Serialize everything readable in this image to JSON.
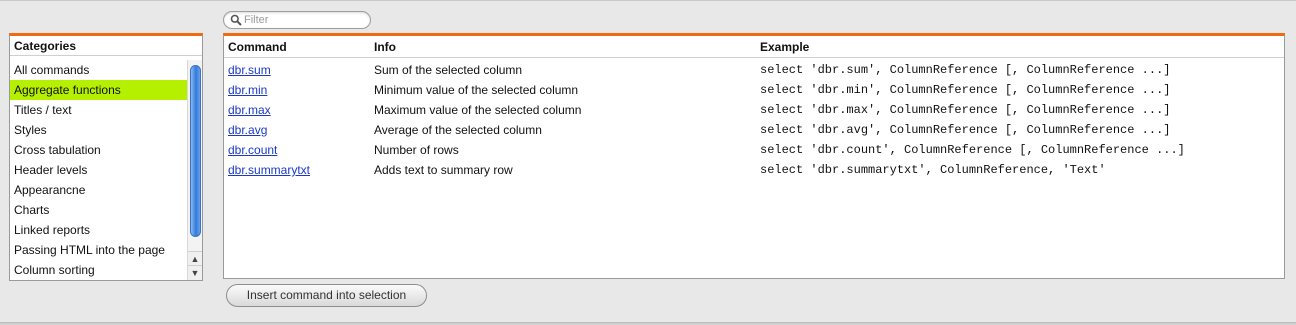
{
  "filter": {
    "placeholder": "Filter",
    "value": ""
  },
  "categories": {
    "header": "Categories",
    "selected_index": 1,
    "items": [
      "All commands",
      "Aggregate functions",
      "Titles / text",
      "Styles",
      "Cross tabulation",
      "Header levels",
      "Appearancne",
      "Charts",
      "Linked reports",
      "Passing HTML into the page",
      "Column sorting"
    ]
  },
  "commands": {
    "columns": {
      "command": "Command",
      "info": "Info",
      "example": "Example"
    },
    "rows": [
      {
        "command": "dbr.sum",
        "info": "Sum of the selected column",
        "example": "select 'dbr.sum', ColumnReference [, ColumnReference ...]"
      },
      {
        "command": "dbr.min",
        "info": "Minimum value of the selected column",
        "example": "select 'dbr.min', ColumnReference [, ColumnReference ...]"
      },
      {
        "command": "dbr.max",
        "info": "Maximum value of the selected column",
        "example": "select 'dbr.max', ColumnReference [, ColumnReference ...]"
      },
      {
        "command": "dbr.avg",
        "info": "Average of the selected column",
        "example": "select 'dbr.avg', ColumnReference [, ColumnReference ...]"
      },
      {
        "command": "dbr.count",
        "info": "Number of rows",
        "example": "select 'dbr.count', ColumnReference [, ColumnReference ...]"
      },
      {
        "command": "dbr.summarytxt",
        "info": "Adds text to summary row",
        "example": "select 'dbr.summarytxt', ColumnReference, 'Text'"
      }
    ]
  },
  "insert_button": {
    "label": "Insert command into selection"
  },
  "colors": {
    "accent": "#f26a10",
    "selection": "#b4f000",
    "link": "#1a39c9"
  }
}
